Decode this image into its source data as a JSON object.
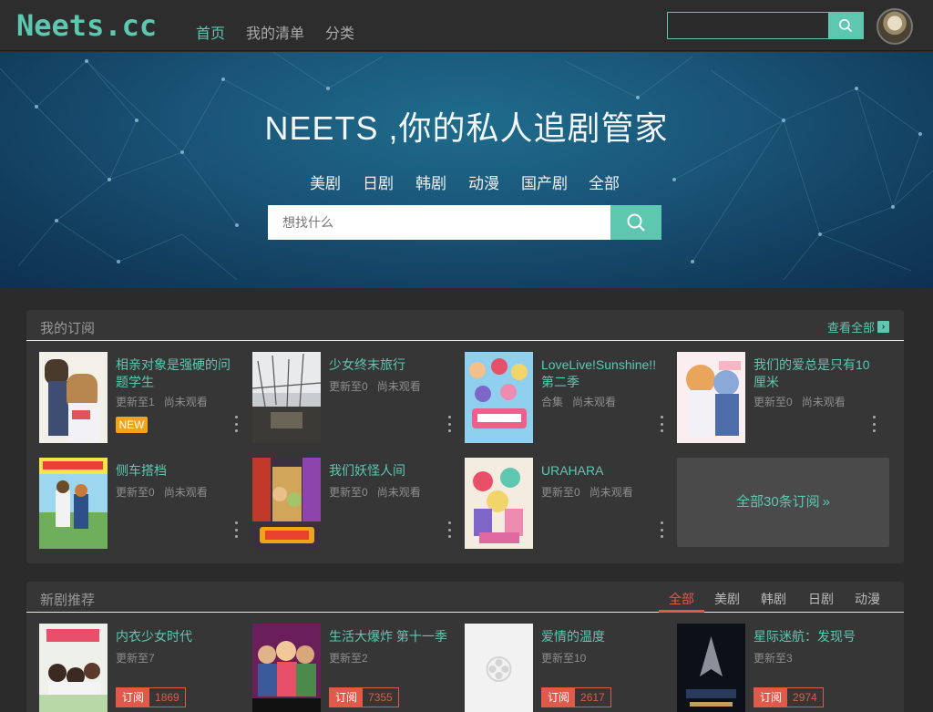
{
  "logo": "Neets.cc",
  "nav": [
    {
      "label": "首页",
      "active": true
    },
    {
      "label": "我的清单",
      "active": false
    },
    {
      "label": "分类",
      "active": false
    }
  ],
  "top_search": {
    "placeholder": ""
  },
  "hero": {
    "title": "NEETS ,你的私人追剧管家",
    "categories": [
      "美剧",
      "日剧",
      "韩剧",
      "动漫",
      "国产剧",
      "全部"
    ],
    "search_placeholder": "想找什么"
  },
  "subscriptions": {
    "title": "我的订阅",
    "see_all": "查看全部",
    "items": [
      {
        "title": "相亲对象是强硬的问题学生",
        "update": "更新至1",
        "watched": "尚未观看",
        "badge": "NEW"
      },
      {
        "title": "少女终末旅行",
        "update": "更新至0",
        "watched": "尚未观看"
      },
      {
        "title": "LoveLive!Sunshine!! 第二季",
        "update": "合集",
        "watched": "尚未观看"
      },
      {
        "title": "我们的爱总是只有10厘米",
        "update": "更新至0",
        "watched": "尚未观看"
      },
      {
        "title": "侧车搭档",
        "update": "更新至0",
        "watched": "尚未观看"
      },
      {
        "title": "我们妖怪人间",
        "update": "更新至0",
        "watched": "尚未观看"
      },
      {
        "title": "URAHARA",
        "update": "更新至0",
        "watched": "尚未观看"
      }
    ],
    "more_label": "全部30条订阅",
    "more_arrow": "»"
  },
  "new_shows": {
    "title": "新剧推荐",
    "tabs": [
      "全部",
      "美剧",
      "韩剧",
      "日剧",
      "动漫"
    ],
    "active_tab": "全部",
    "items": [
      {
        "title": "内衣少女时代",
        "update": "更新至7",
        "sub_label": "订阅",
        "count": "1869"
      },
      {
        "title": "生活大爆炸 第十一季",
        "update": "更新至2",
        "sub_label": "订阅",
        "count": "7355"
      },
      {
        "title": "爱情的温度",
        "update": "更新至10",
        "sub_label": "订阅",
        "count": "2617"
      },
      {
        "title": "星际迷航：发现号",
        "update": "更新至3",
        "sub_label": "订阅",
        "count": "2974"
      }
    ]
  },
  "colors": {
    "accent": "#5ec7b0",
    "subscribe": "#e05a4a",
    "new_badge": "#f0a418"
  }
}
